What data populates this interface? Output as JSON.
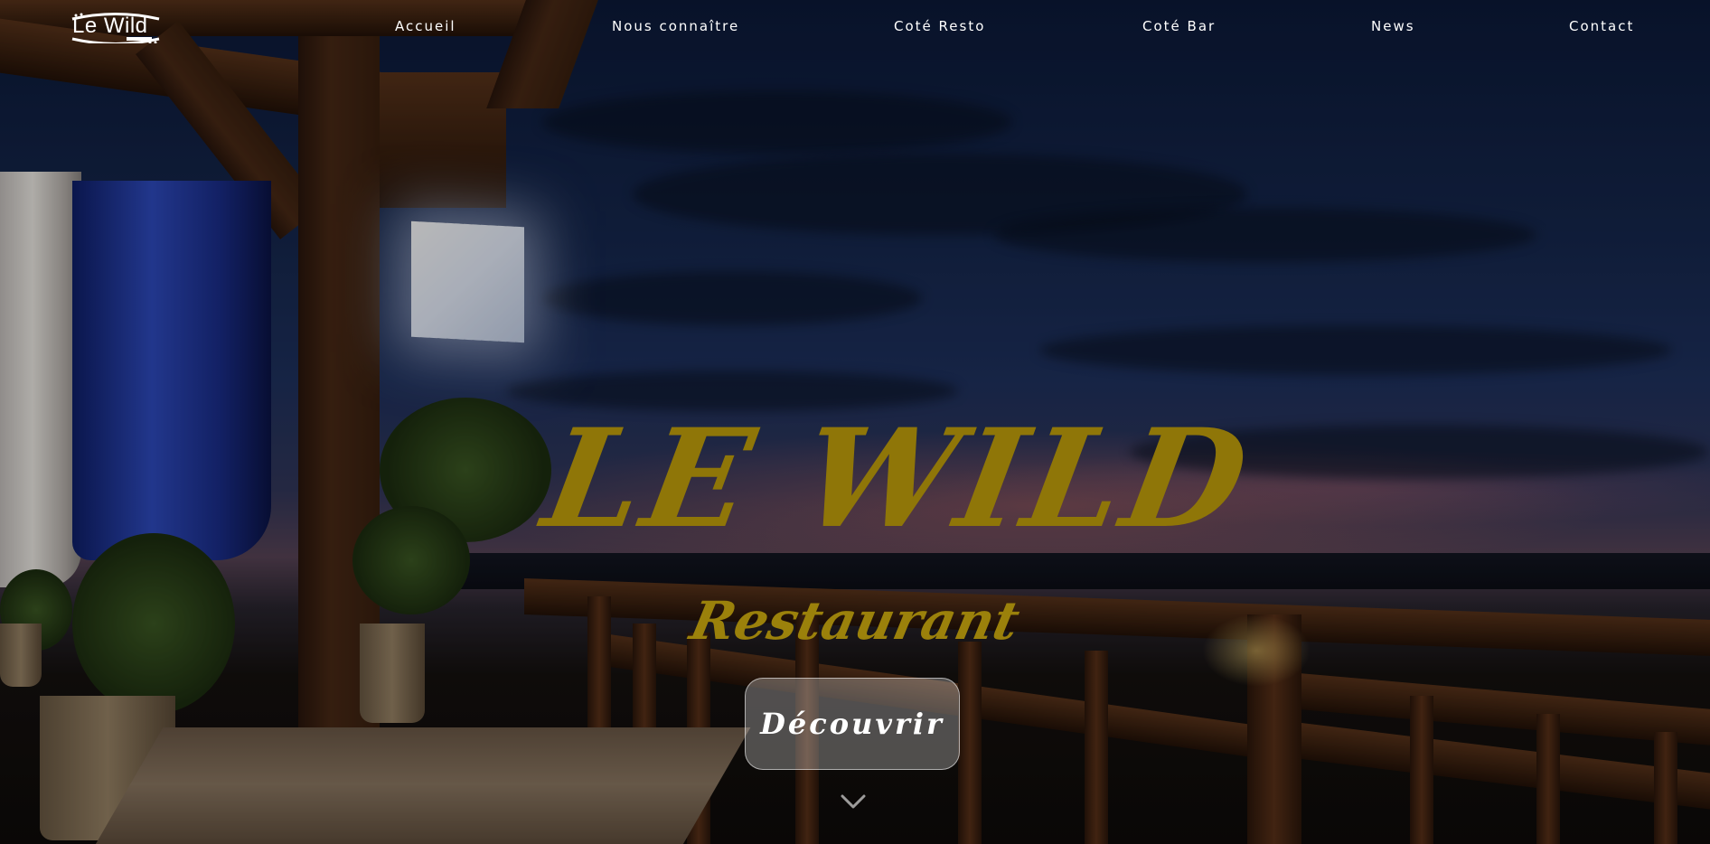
{
  "header": {
    "logo_text": "Le Wild",
    "nav": [
      {
        "label": "Accueil"
      },
      {
        "label": "Nous connaître"
      },
      {
        "label": "Coté Resto"
      },
      {
        "label": "Coté Bar"
      },
      {
        "label": "News"
      },
      {
        "label": "Contact"
      }
    ]
  },
  "hero": {
    "title": "LE WILD",
    "subtitle": "Restaurant",
    "cta_label": "Découvrir",
    "scroll_icon": "chevron-down-icon"
  },
  "colors": {
    "title_gold": "#8f7608",
    "subtitle_gold": "#9b810b",
    "nav_text": "#ffffff",
    "button_bg": "rgba(255,255,255,0.28)"
  }
}
